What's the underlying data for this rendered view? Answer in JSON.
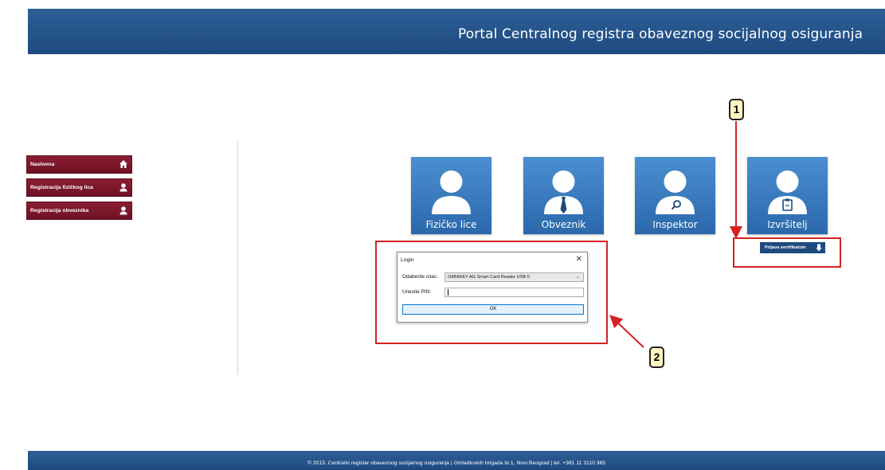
{
  "header": {
    "title": "Portal Centralnog registra obaveznog socijalnog osiguranja"
  },
  "sidebar": {
    "items": [
      {
        "label": "Naslovna",
        "icon": "home-icon"
      },
      {
        "label": "Registracija fizičkog lica",
        "icon": "user-icon"
      },
      {
        "label": "Registracija obveznika",
        "icon": "user-icon"
      }
    ]
  },
  "tiles": [
    {
      "label": "Fizičko lice",
      "icon": "person-icon"
    },
    {
      "label": "Obveznik",
      "icon": "person-tie-icon"
    },
    {
      "label": "Inspektor",
      "icon": "person-search-icon"
    },
    {
      "label": "Izvršitelj",
      "icon": "person-clipboard-icon"
    }
  ],
  "cert_button": {
    "label": "Prijava sertifikatom",
    "icon": "download-icon"
  },
  "dialog": {
    "title": "Login",
    "reader_label": "Odaberite citac:",
    "reader_value": "OMNIKEY AG Smart Card Reader USB 0",
    "pin_label": "Unesite PIN:",
    "pin_value": "",
    "ok_label": "OK"
  },
  "callouts": [
    "1",
    "2"
  ],
  "footer": {
    "text": "© 2013. Centralni registar obaveznog socijalnog osiguranja | Omladinskih brigada br.1, Novi Beograd | tel. +381 11 3110 365"
  },
  "colors": {
    "header": "#1e4a80",
    "sidebar": "#7a1529",
    "tile": "#3a7cc1",
    "annotation": "#d42222",
    "callout": "#fff6c2"
  }
}
